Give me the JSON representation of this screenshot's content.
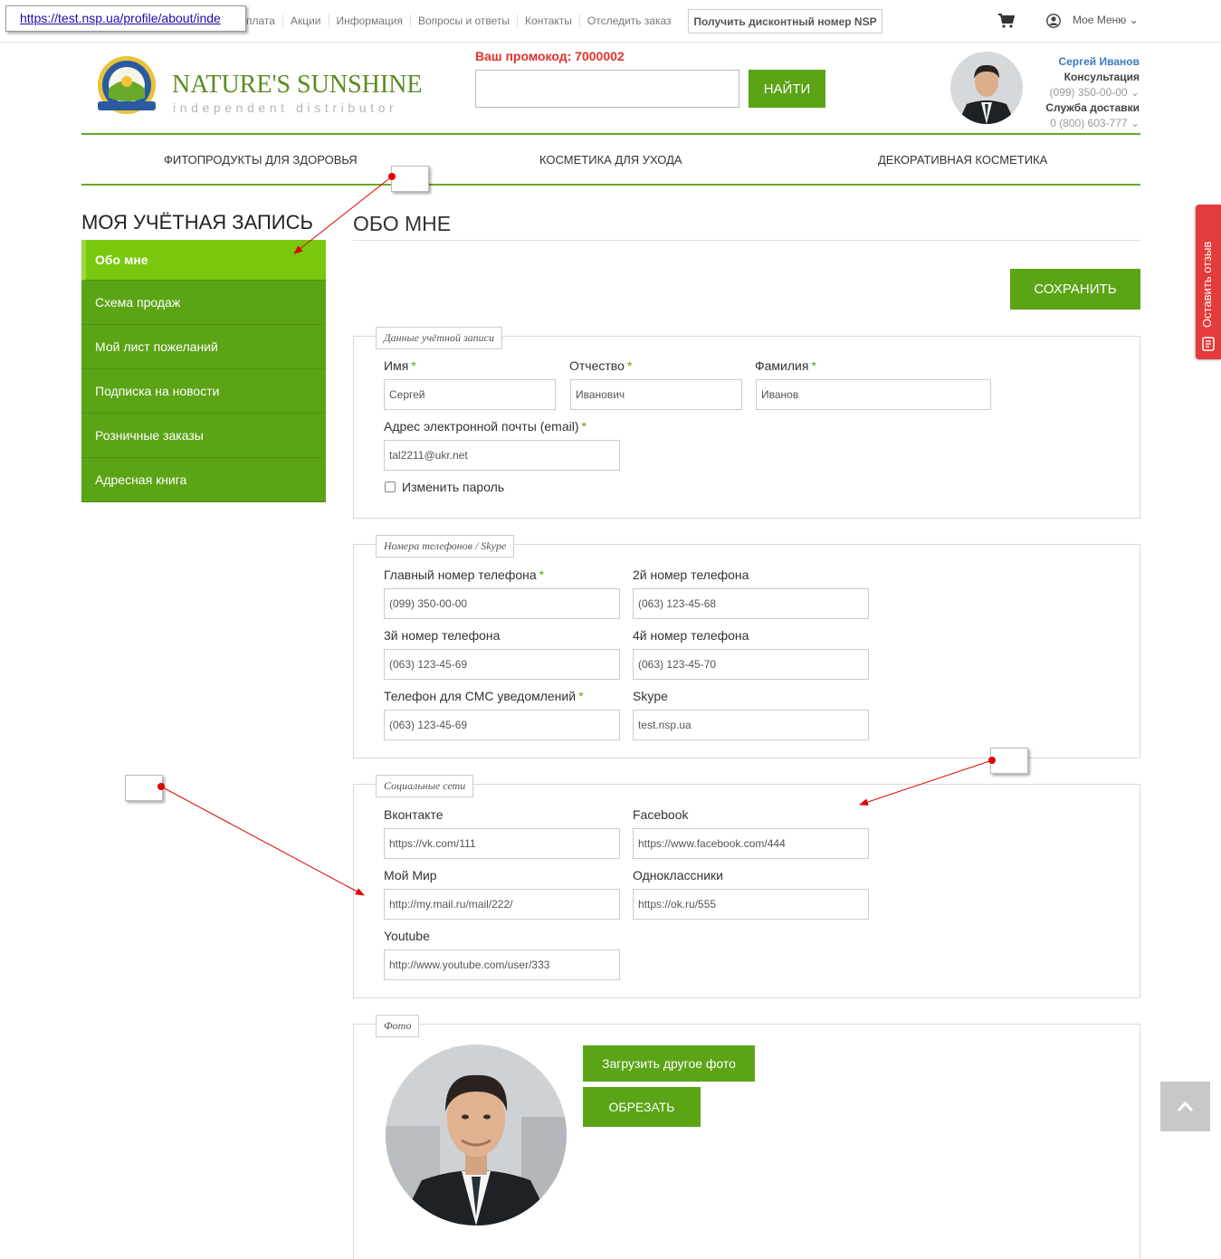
{
  "url_tooltip": "https://test.nsp.ua/profile/about/inde",
  "topnav": {
    "items": [
      "плата",
      "Акции",
      "Информация",
      "Вопросы и ответы",
      "Контакты",
      "Отследить заказ"
    ],
    "discount_button": "Получить дисконтный номер NSP",
    "my_menu": "Мое Меню"
  },
  "header": {
    "logo_title": "NATURE'S SUNSHINE",
    "logo_subtitle": "independent distributor",
    "promo_label": "Ваш промокод: 7000002",
    "search_button": "НАЙТИ",
    "user_name": "Сергей Иванов",
    "consult_label": "Консультация",
    "consult_phone": "(099) 350-00-00",
    "delivery_label": "Служба доставки",
    "delivery_phone": "0 (800) 603-777"
  },
  "categories": [
    "ФИТОПРОДУКТЫ ДЛЯ ЗДОРОВЬЯ",
    "КОСМЕТИКА ДЛЯ УХОДА",
    "ДЕКОРАТИВНАЯ КОСМЕТИКА"
  ],
  "sidebar": {
    "title": "МОЯ УЧЁТНАЯ ЗАПИСЬ",
    "items": [
      "Обо мне",
      "Схема продаж",
      "Мой лист пожеланий",
      "Подписка на новости",
      "Розничные заказы",
      "Адресная книга"
    ]
  },
  "page": {
    "title": "ОБО МНЕ",
    "save_button": "СОХРАНИТЬ"
  },
  "account": {
    "legend": "Данные учётной записи",
    "first_name_label": "Имя",
    "first_name": "Сергей",
    "patronymic_label": "Отчество",
    "patronymic": "Иванович",
    "last_name_label": "Фамилия",
    "last_name": "Иванов",
    "email_label": "Адрес электронной почты (email)",
    "email": "tal2211@ukr.net",
    "change_password": "Изменить пароль"
  },
  "phones": {
    "legend": "Номера телефонов / Skype",
    "main_label": "Главный номер телефона",
    "main": "(099) 350-00-00",
    "second_label": "2й номер телефона",
    "second": "(063) 123-45-68",
    "third_label": "3й номер телефона",
    "third": "(063) 123-45-69",
    "fourth_label": "4й номер телефона",
    "fourth": "(063) 123-45-70",
    "sms_label": "Телефон для СМС уведомлений",
    "sms": "(063) 123-45-69",
    "skype_label": "Skype",
    "skype": "test.nsp.ua"
  },
  "social": {
    "legend": "Социальные сети",
    "vk_label": "Вконтакте",
    "vk": "https://vk.com/111",
    "fb_label": "Facebook",
    "fb": "https://www.facebook.com/444",
    "mymir_label": "Мой Мир",
    "mymir": "http://my.mail.ru/mail/222/",
    "ok_label": "Одноклассники",
    "ok": "https://ok.ru/555",
    "yt_label": "Youtube",
    "yt": "http://www.youtube.com/user/333"
  },
  "photo": {
    "legend": "Фото",
    "upload_button": "Загрузить другое фото",
    "crop_button": "ОБРЕЗАТЬ"
  },
  "feedback_tab": "Оставить отзыв",
  "colors": {
    "brand_green": "#5aa416",
    "active_green": "#79c80e",
    "promo_red": "#e5322b",
    "feedback_red": "#e43b3b",
    "annotation_red": "#e00000"
  }
}
